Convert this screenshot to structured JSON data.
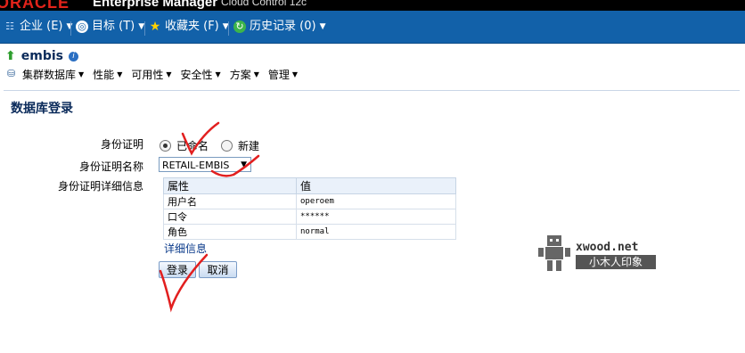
{
  "topbar": {
    "brand": "ORACLE",
    "product": "Enterprise Manager",
    "sub": "Cloud Control 12c"
  },
  "nav": {
    "enterprise": {
      "label": "企业 (E)"
    },
    "targets": {
      "label": "目标 (T)"
    },
    "favorites": {
      "label": "收藏夹 (F)"
    },
    "history": {
      "label": "历史记录 (0)"
    }
  },
  "target": {
    "name": "embis"
  },
  "menu": [
    "集群数据库",
    "性能",
    "可用性",
    "安全性",
    "方案",
    "管理"
  ],
  "page": {
    "title": "数据库登录"
  },
  "form": {
    "credential_label": "身份证明",
    "radio_named": "已命名",
    "radio_new": "新建",
    "credential_name_label": "身份证明名称",
    "credential_name_value": "RETAIL-EMBIS",
    "details_label": "身份证明详细信息",
    "table": {
      "headers": [
        "属性",
        "值"
      ],
      "rows": [
        [
          "用户名",
          "operoem"
        ],
        [
          "口令",
          "******"
        ],
        [
          "角色",
          "normal"
        ]
      ]
    },
    "more_details_link": "详细信息",
    "login_button": "登录",
    "cancel_button": "取消"
  },
  "watermark": {
    "site": "xwood.net",
    "text": "小木人印象"
  },
  "colors": {
    "nav": "#1261a9",
    "brand_red": "#e2231a",
    "annotation_red": "#e21f1f"
  }
}
